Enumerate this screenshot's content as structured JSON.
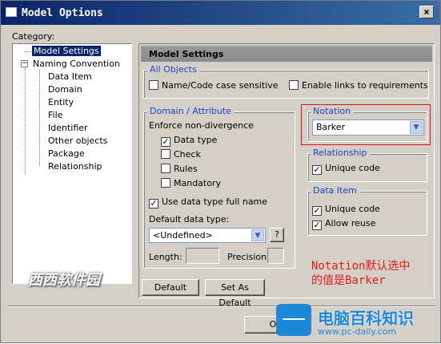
{
  "window": {
    "title": "Model Options",
    "close_glyph": "×"
  },
  "category": {
    "label": "Category:",
    "tree": [
      {
        "label": "Model Settings"
      },
      {
        "label": "Naming Convention"
      },
      {
        "label": "Data Item"
      },
      {
        "label": "Domain"
      },
      {
        "label": "Entity"
      },
      {
        "label": "File"
      },
      {
        "label": "Identifier"
      },
      {
        "label": "Other objects"
      },
      {
        "label": "Package"
      },
      {
        "label": "Relationship"
      }
    ],
    "expander_glyph": "−"
  },
  "panel": {
    "header": "Model Settings",
    "all_objects": {
      "title": "All Objects",
      "name_code_case_sensitive": {
        "label": "Name/Code case sensitive",
        "checked": false
      },
      "enable_links": {
        "label": "Enable links to requirements",
        "checked": false
      }
    },
    "domain_attribute": {
      "title": "Domain / Attribute",
      "enforce_label": "Enforce non-divergence",
      "data_type": {
        "label": "Data type",
        "checked": true
      },
      "check": {
        "label": "Check",
        "checked": false
      },
      "rules": {
        "label": "Rules",
        "checked": false
      },
      "mandatory": {
        "label": "Mandatory",
        "checked": false
      },
      "use_full_name": {
        "label": "Use data type full name",
        "checked": true
      },
      "default_type_label": "Default data type:",
      "default_type_value": "<Undefined>",
      "help_button": "?",
      "length_label": "Length:",
      "precision_label": "Precision:"
    },
    "notation": {
      "title": "Notation",
      "value": "Barker"
    },
    "relationship": {
      "title": "Relationship",
      "unique_code": {
        "label": "Unique code",
        "checked": true
      }
    },
    "data_item": {
      "title": "Data Item",
      "unique_code": {
        "label": "Unique code",
        "checked": true
      },
      "allow_reuse": {
        "label": "Allow reuse",
        "checked": true
      }
    },
    "default_button": "Default",
    "set_as_default_button": "Set As Default"
  },
  "footer": {
    "ok_button_partial": "O"
  },
  "annotation": {
    "line1": "Notation默认选中",
    "line2": "的值是Barker"
  },
  "watermark": {
    "left_text": "西西软件园"
  },
  "brand": {
    "name": "电脑百科知识",
    "url": "www.pc-daily.com"
  },
  "colors": {
    "accent_blue": "#1a44c8",
    "annotation_red": "#e21a1a",
    "selection": "#0a246a"
  },
  "check_glyph": "✓",
  "dropdown_glyph": "▼"
}
